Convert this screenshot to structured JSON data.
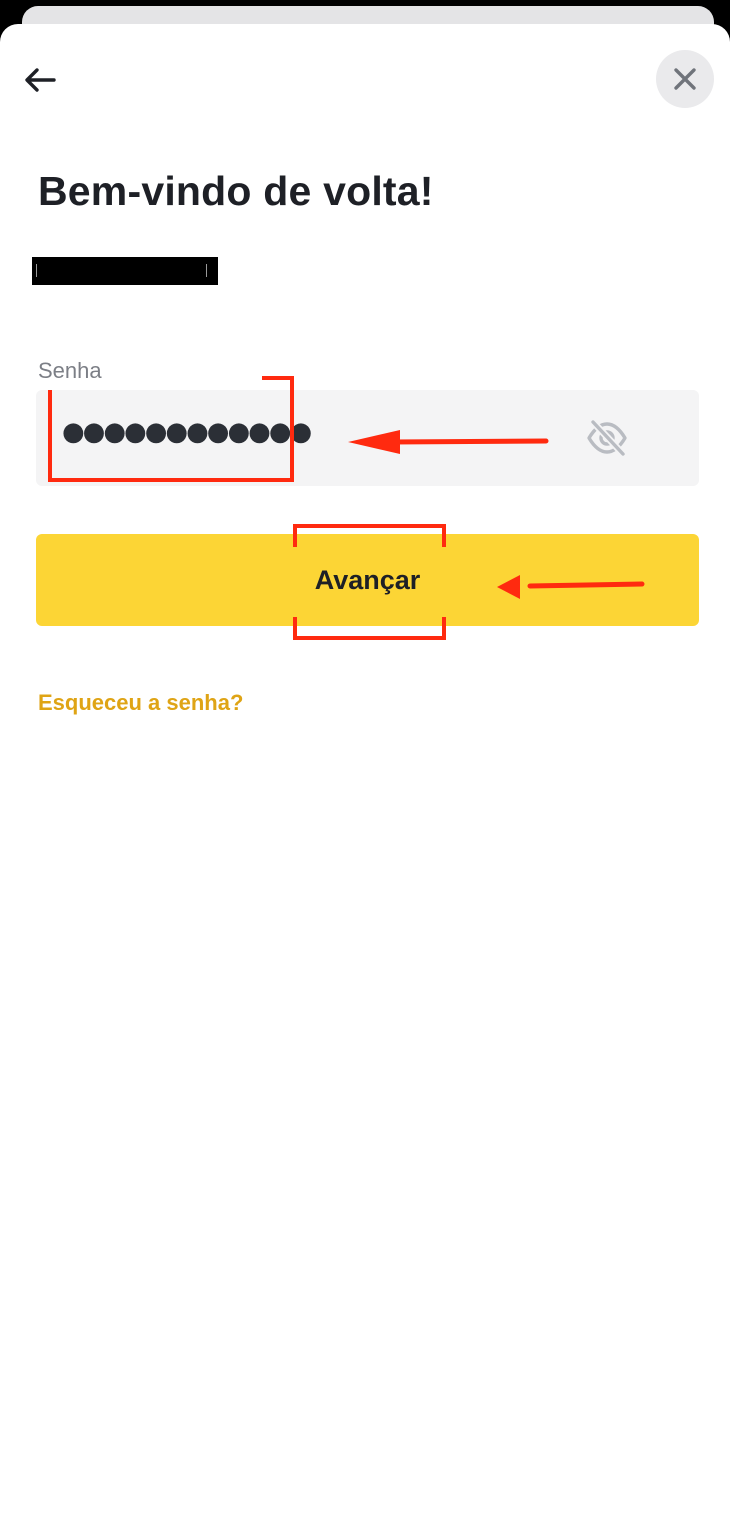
{
  "icons": {
    "back": "arrow-left-icon",
    "close": "close-icon",
    "visibility": "eye-off-icon"
  },
  "colors": {
    "primary": "#fcd535",
    "link": "#dfa415",
    "text": "#1e2026",
    "muted": "#7c7f86",
    "field_bg": "#f4f4f5",
    "annotation": "#ff2a0f"
  },
  "header": {
    "title": "Bem-vindo de volta!"
  },
  "password": {
    "label": "Senha",
    "value": "●●●●●●●●●●●●"
  },
  "actions": {
    "submit_label": "Avançar",
    "forgot_label": "Esqueceu a senha?"
  }
}
